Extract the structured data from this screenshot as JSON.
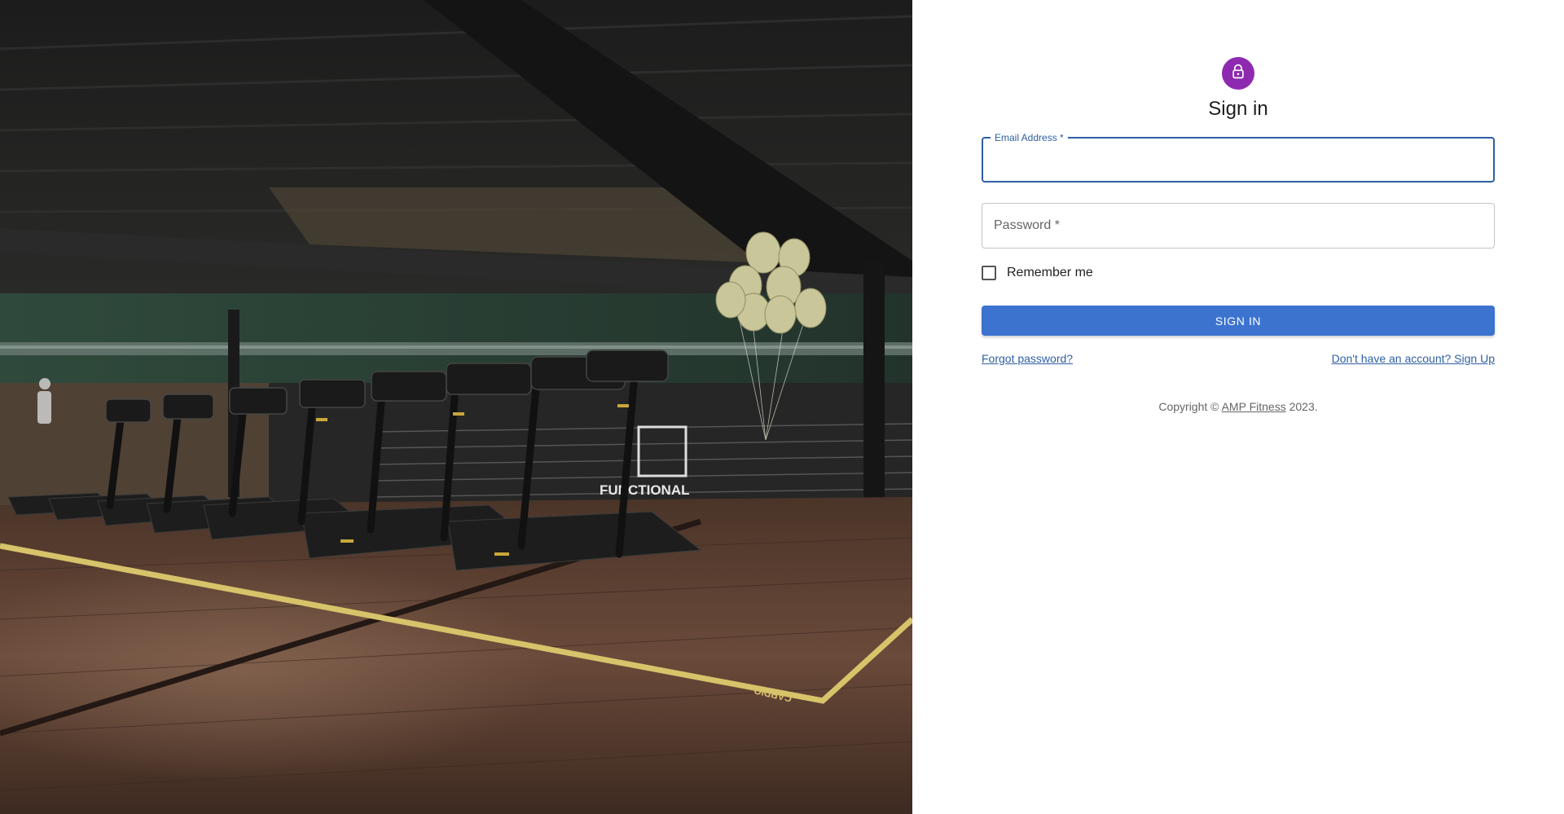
{
  "colors": {
    "accent": "#3b73cf",
    "avatar_bg": "#8e2ab0",
    "focus_border": "#2f5fa5",
    "link": "#2f5fa5"
  },
  "hero": {
    "image_icon": "gym-treadmills-photo",
    "floor_text": "CARDIO",
    "wall_text": "FUNCTIONAL"
  },
  "signin": {
    "avatar_icon": "lock-icon",
    "title": "Sign in",
    "email": {
      "label": "Email Address *",
      "value": ""
    },
    "password": {
      "label": "Password *",
      "value": ""
    },
    "remember_label": "Remember me",
    "submit_label": "SIGN IN",
    "forgot_link": "Forgot password?",
    "signup_link": "Don't have an account? Sign Up",
    "copyright": {
      "prefix": "Copyright © ",
      "link": "AMP Fitness",
      "suffix": " 2023."
    }
  }
}
